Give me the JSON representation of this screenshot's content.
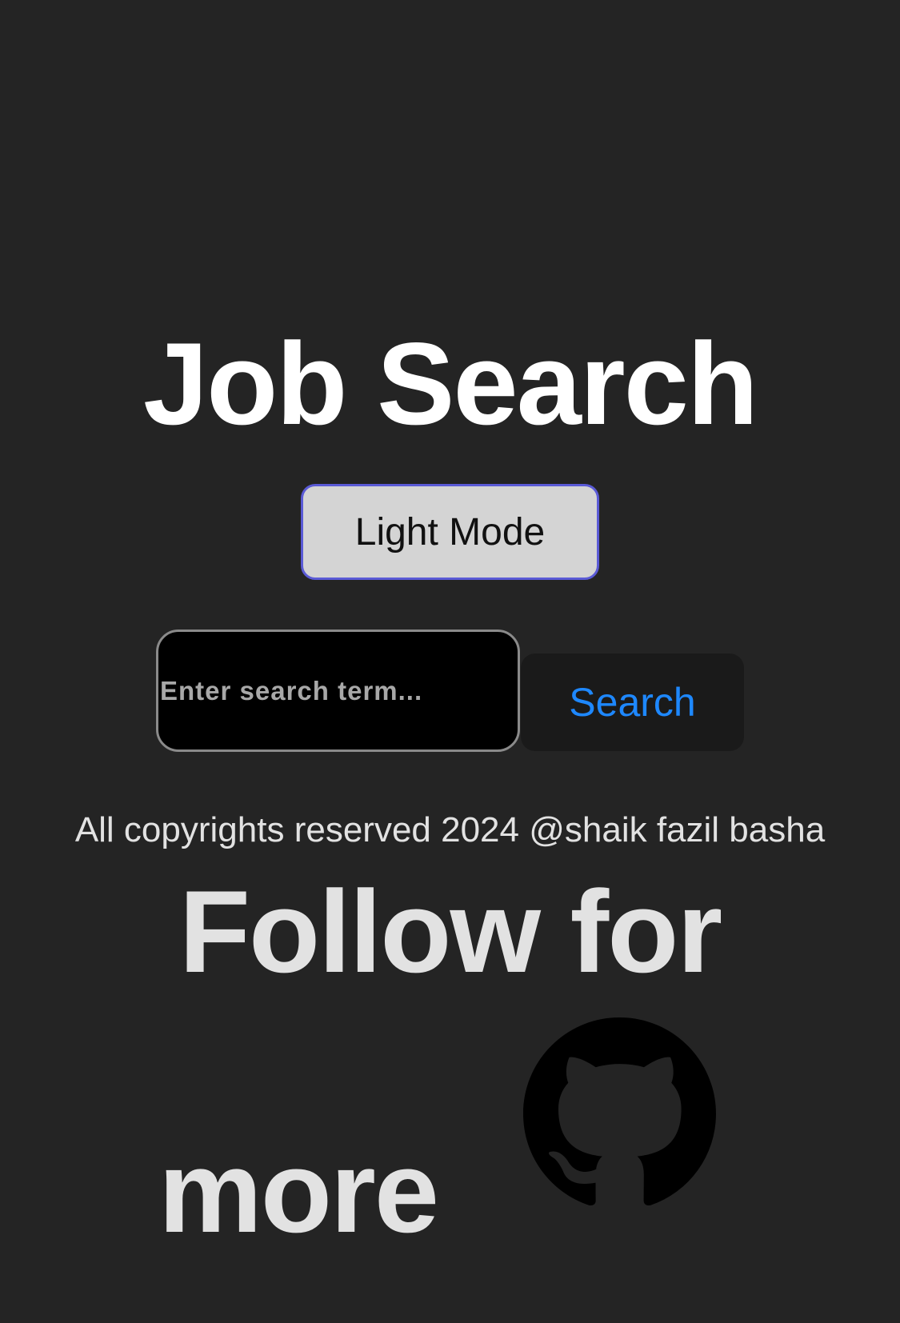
{
  "header": {
    "title": "Job Search"
  },
  "theme_toggle": {
    "label": "Light Mode"
  },
  "search": {
    "placeholder": "Enter search term...",
    "value": "",
    "button_label": "Search"
  },
  "footer": {
    "copyright": "All copyrights reserved 2024 @shaik fazil basha",
    "follow_line1": "Follow for",
    "follow_line2": "more",
    "social_icon": "github-icon"
  },
  "colors": {
    "background": "#242424",
    "title": "#ffffff",
    "accent_link": "#1e88ff",
    "toggle_border": "#5a5ad6",
    "toggle_background": "#d4d4d4"
  }
}
